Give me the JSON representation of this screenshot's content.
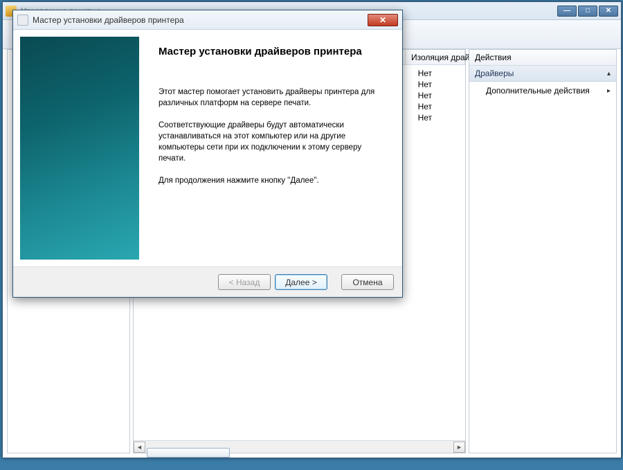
{
  "main_window": {
    "title": "Управление печатью",
    "win_min": "—",
    "win_max": "□",
    "win_close": "✕",
    "list": {
      "col_isolation": "Изоляция драй",
      "rows": [
        "Нет",
        "Нет",
        "Нет",
        "Нет",
        "Нет"
      ]
    },
    "actions": {
      "title": "Действия",
      "group_label": "Драйверы",
      "group_chev": "▴",
      "item_more": "Дополнительные действия",
      "item_chev": "▸"
    },
    "scroll_left": "◄",
    "scroll_right": "►"
  },
  "wizard": {
    "title": "Мастер установки драйверов принтера",
    "close": "✕",
    "heading": "Мастер установки драйверов принтера",
    "p1": "Этот мастер помогает установить драйверы принтера для различных платформ на сервере печати.",
    "p2": "Соответствующие драйверы будут автоматически устанавливаться на этот компьютер или на другие компьютеры сети при их подключении к этому серверу печати.",
    "p3": "Для продолжения нажмите кнопку ''Далее''.",
    "btn_back": "< Назад",
    "btn_next": "Далее >",
    "btn_cancel": "Отмена"
  }
}
